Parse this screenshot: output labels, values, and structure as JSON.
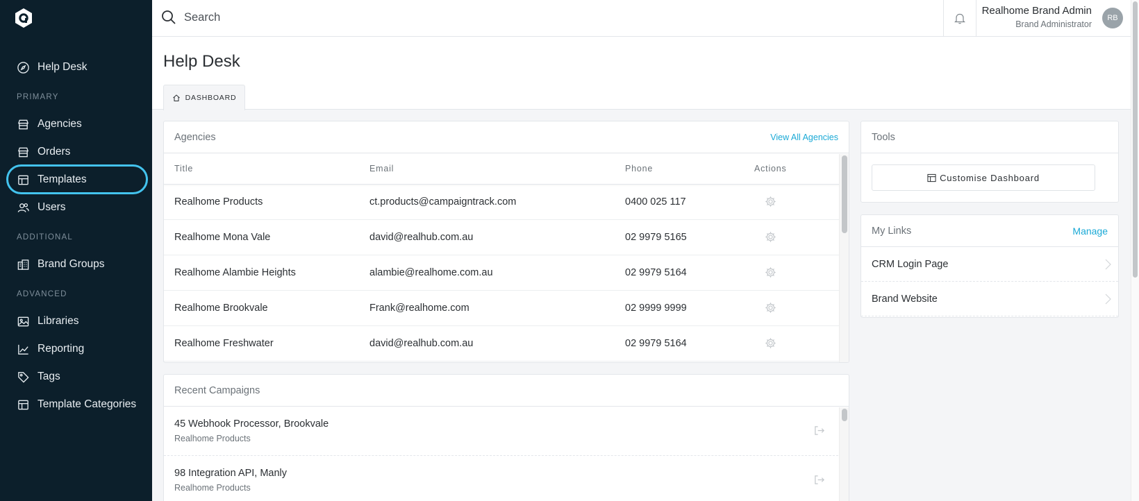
{
  "sidebar": {
    "logo": "realhub-logo",
    "items": [
      {
        "label": "Help Desk",
        "icon": "compass-icon"
      },
      {
        "label": "Agencies",
        "icon": "store-icon"
      },
      {
        "label": "Orders",
        "icon": "store-icon"
      },
      {
        "label": "Templates",
        "icon": "grid-icon"
      },
      {
        "label": "Users",
        "icon": "users-icon"
      },
      {
        "label": "Brand Groups",
        "icon": "building-icon"
      },
      {
        "label": "Libraries",
        "icon": "image-icon"
      },
      {
        "label": "Reporting",
        "icon": "chart-icon"
      },
      {
        "label": "Tags",
        "icon": "tag-icon"
      },
      {
        "label": "Template Categories",
        "icon": "grid-icon"
      }
    ],
    "sections": {
      "primary": "PRIMARY",
      "additional": "ADDITIONAL",
      "advanced": "ADVANCED"
    },
    "highlighted": "Templates",
    "highlight_color": "#43c3ee"
  },
  "topbar": {
    "search_placeholder": "Search",
    "user_name": "Realhome Brand Admin",
    "user_role": "Brand Administrator",
    "avatar_initials": "RB"
  },
  "page": {
    "title": "Help Desk",
    "tab": "DASHBOARD"
  },
  "agencies": {
    "title": "Agencies",
    "view_all": "View All Agencies",
    "columns": [
      "Title",
      "Email",
      "Phone",
      "Actions"
    ],
    "rows": [
      {
        "title": "Realhome Products",
        "email": "ct.products@campaigntrack.com",
        "phone": "0400 025 117"
      },
      {
        "title": "Realhome Mona Vale",
        "email": "david@realhub.com.au",
        "phone": "02 9979 5165"
      },
      {
        "title": "Realhome Alambie Heights",
        "email": "alambie@realhome.com.au",
        "phone": "02 9979 5164"
      },
      {
        "title": "Realhome Brookvale",
        "email": "Frank@realhome.com",
        "phone": "02 9999 9999"
      },
      {
        "title": "Realhome Freshwater",
        "email": "david@realhub.com.au",
        "phone": "02 9979 5164"
      }
    ]
  },
  "campaigns": {
    "title": "Recent Campaigns",
    "rows": [
      {
        "title": "45 Webhook Processor, Brookvale",
        "agency": "Realhome Products"
      },
      {
        "title": "98 Integration API, Manly",
        "agency": "Realhome Products"
      }
    ]
  },
  "tools": {
    "title": "Tools",
    "customise_label": "Customise Dashboard"
  },
  "my_links": {
    "title": "My Links",
    "manage_label": "Manage",
    "items": [
      "CRM Login Page",
      "Brand Website"
    ]
  },
  "colors": {
    "sidebar_bg": "#0c1f2b",
    "accent": "#1aa9d6"
  }
}
